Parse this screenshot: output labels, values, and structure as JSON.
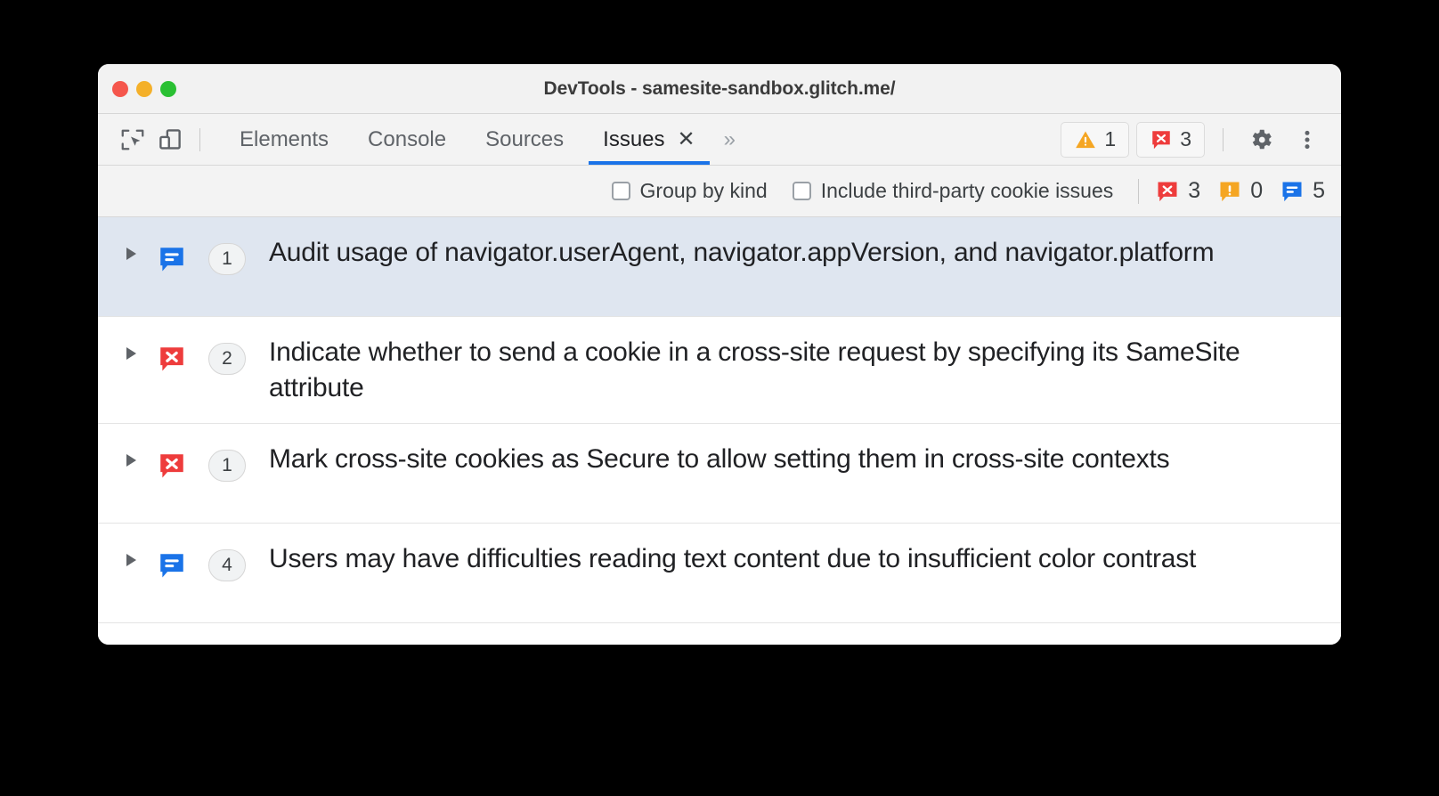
{
  "window": {
    "title": "DevTools - samesite-sandbox.glitch.me/",
    "traffic_lights": [
      "close",
      "minimize",
      "maximize"
    ],
    "colors": {
      "close": "#f5564c",
      "minimize": "#f4b02a",
      "maximize": "#2ac033",
      "accent": "#1a73e8",
      "error": "#ee3c3c",
      "warning": "#f5a623",
      "info": "#1a73e8",
      "selected_row": "#dfe6f0"
    }
  },
  "toolbar": {
    "inspect_icon": "inspect-element-icon",
    "device_icon": "device-toolbar-icon",
    "tabs": [
      {
        "label": "Elements",
        "active": false,
        "closable": false
      },
      {
        "label": "Console",
        "active": false,
        "closable": false
      },
      {
        "label": "Sources",
        "active": false,
        "closable": false
      },
      {
        "label": "Issues",
        "active": true,
        "closable": true
      }
    ],
    "tab_close_glyph": "✕",
    "overflow_label": "»",
    "warning_count": "1",
    "error_count": "3",
    "settings_icon": "gear-icon",
    "more_icon": "kebab-menu-icon"
  },
  "filterbar": {
    "group_by_kind": {
      "label": "Group by kind",
      "checked": false
    },
    "third_party": {
      "label": "Include third-party cookie issues",
      "checked": false
    },
    "counts": {
      "errors": "3",
      "warnings": "0",
      "info": "5"
    }
  },
  "issues": [
    {
      "kind": "info",
      "count": "1",
      "title": "Audit usage of navigator.userAgent, navigator.appVersion, and navigator.platform",
      "selected": true,
      "expanded": false
    },
    {
      "kind": "error",
      "count": "2",
      "title": "Indicate whether to send a cookie in a cross-site request by specifying its SameSite attribute",
      "selected": false,
      "expanded": false
    },
    {
      "kind": "error",
      "count": "1",
      "title": "Mark cross-site cookies as Secure to allow setting them in cross-site contexts",
      "selected": false,
      "expanded": false
    },
    {
      "kind": "info",
      "count": "4",
      "title": "Users may have difficulties reading text content due to insufficient color contrast",
      "selected": false,
      "expanded": false
    }
  ]
}
